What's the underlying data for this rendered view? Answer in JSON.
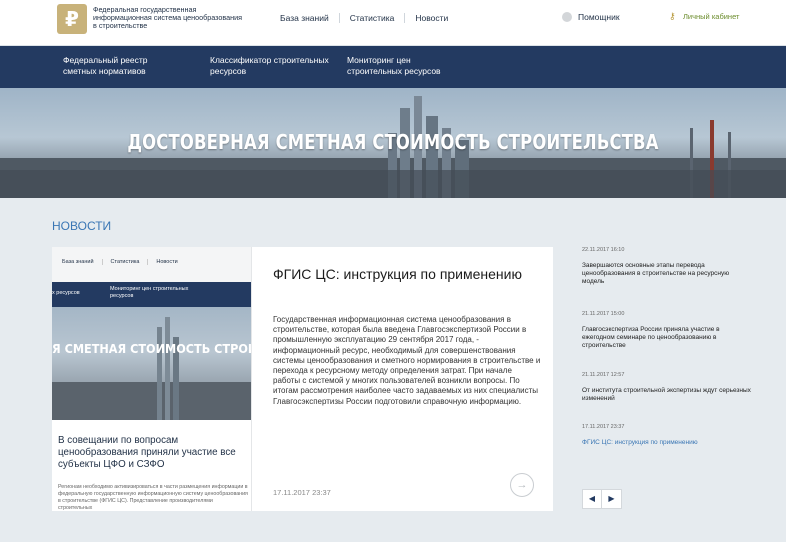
{
  "header": {
    "logo_symbol": "₽",
    "org_name": "Федеральная государственная информационная система ценообразования в строительстве",
    "nav": [
      "База знаний",
      "Статистика",
      "Новости"
    ],
    "helper": "Помощник",
    "cabinet": "Личный кабинет"
  },
  "main_nav": [
    "Федеральный реестр сметных нормативов",
    "Классификатор строительных ресурсов",
    "Мониторинг цен строительных ресурсов"
  ],
  "hero": {
    "title": "ДОСТОВЕРНАЯ СМЕТНАЯ СТОИМОСТЬ СТРОИТЕЛЬСТВА"
  },
  "news_section": {
    "heading": "НОВОСТИ"
  },
  "thumbnail": {
    "nav": [
      "База знаний",
      "Статистика",
      "Новости"
    ],
    "items": [
      "х ресурсов",
      "Мониторинг цен строительных ресурсов"
    ],
    "hero_title": "Я СМЕТНАЯ СТОИМОСТЬ СТРОИ",
    "headline": "В совещании по вопросам ценообразования приняли участие все субъекты ЦФО и СЗФО",
    "text": "Регионам необходимо активизироваться в части размещения информации в федеральную государственную информационную систему ценообразования в строительстве (ФГИС ЦС). Представление производителями строительных"
  },
  "featured": {
    "title": "ФГИС ЦС: инструкция по применению",
    "body": "Государственная информационная система ценообразования в строительстве, которая была введена Главгосэкспертизой России в промышленную эксплуатацию 29 сентября 2017 года, - информационный ресурс, необходимый для совершенствования системы ценообразования и сметного нормирования в строительстве и перехода к ресурсному методу определения затрат. При начале работы с системой у многих пользователей возникли вопросы. По итогам рассмотрения наиболее часто задаваемых из них специалисты Главгосэкспертизы России подготовили справочную информацию.",
    "date": "17.11.2017 23:37",
    "arrow": "→"
  },
  "news_list": [
    {
      "date": "22.11.2017 16:10",
      "title": "Завершаются основные этапы перевода ценообразования в строительстве на ресурсную модель"
    },
    {
      "date": "21.11.2017 15:00",
      "title": "Главгосэкспертиза России приняла участие в ежегодном семинаре по ценообразованию в строительстве"
    },
    {
      "date": "21.11.2017 12:57",
      "title": "От института строительной экспертизы ждут серьезных изменений"
    },
    {
      "date": "17.11.2017 23:37",
      "title": "ФГИС ЦС: инструкция по применению"
    }
  ],
  "pager": {
    "prev": "◀",
    "next": "▶"
  }
}
